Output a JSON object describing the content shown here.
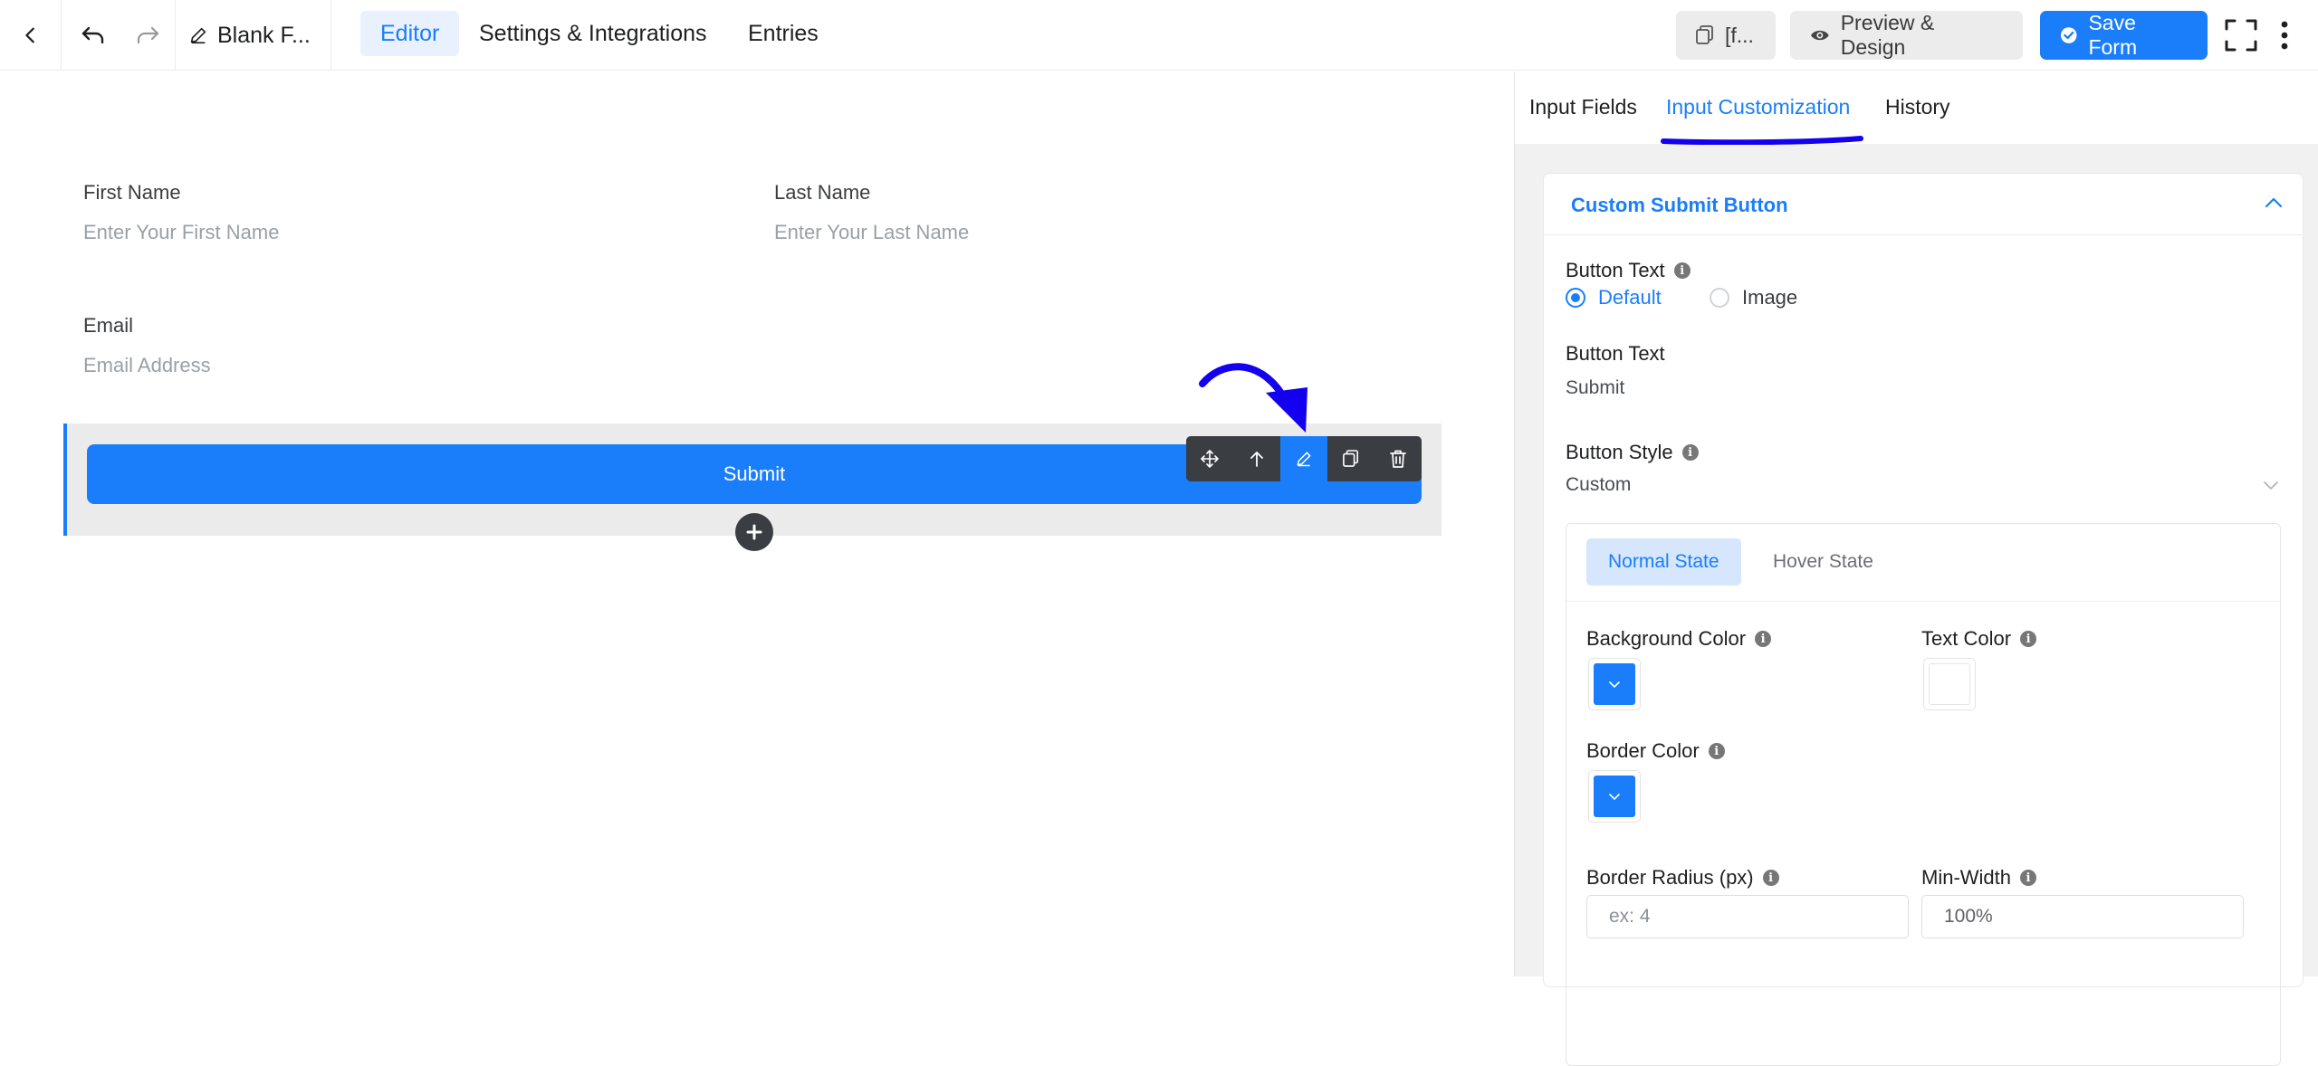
{
  "topbar": {
    "form_title": "Blank F...",
    "tabs": [
      {
        "label": "Editor",
        "active": true
      },
      {
        "label": "Settings & Integrations",
        "active": false
      },
      {
        "label": "Entries",
        "active": false
      }
    ],
    "shortcode_label": "[f...",
    "preview_label": "Preview & Design",
    "save_label": "Save Form"
  },
  "form": {
    "first_name_label": "First Name",
    "first_name_placeholder": "Enter Your First Name",
    "last_name_label": "Last Name",
    "last_name_placeholder": "Enter Your Last Name",
    "email_label": "Email",
    "email_placeholder": "Email Address",
    "submit_label": "Submit"
  },
  "panel": {
    "tabs": [
      {
        "label": "Input Fields",
        "active": false
      },
      {
        "label": "Input Customization",
        "active": true
      },
      {
        "label": "History",
        "active": false
      }
    ],
    "section_title": "Custom Submit Button",
    "button_text_label": "Button Text",
    "radio_default": "Default",
    "radio_image": "Image",
    "button_text_label_2": "Button Text",
    "button_text_value": "Submit",
    "button_style_label": "Button Style",
    "button_style_value": "Custom",
    "state_normal": "Normal State",
    "state_hover": "Hover State",
    "bg_color_label": "Background Color",
    "text_color_label": "Text Color",
    "border_color_label": "Border Color",
    "border_radius_label": "Border Radius (px)",
    "border_radius_placeholder": "ex: 4",
    "min_width_label": "Min-Width",
    "min_width_value": "100%"
  },
  "colors": {
    "accent": "#1a7efb",
    "annotation": "#1200ee",
    "toolbar_dark": "#3a3d42"
  },
  "icons": [
    "back-icon",
    "undo-icon",
    "redo-icon",
    "edit-icon",
    "copy-icon",
    "eye-icon",
    "check-circle-icon",
    "fullscreen-icon",
    "more-vertical-icon",
    "move-icon",
    "arrow-up-icon",
    "pencil-icon",
    "duplicate-icon",
    "trash-icon",
    "plus-icon",
    "chevron-up-icon",
    "chevron-down-icon",
    "info-icon"
  ]
}
